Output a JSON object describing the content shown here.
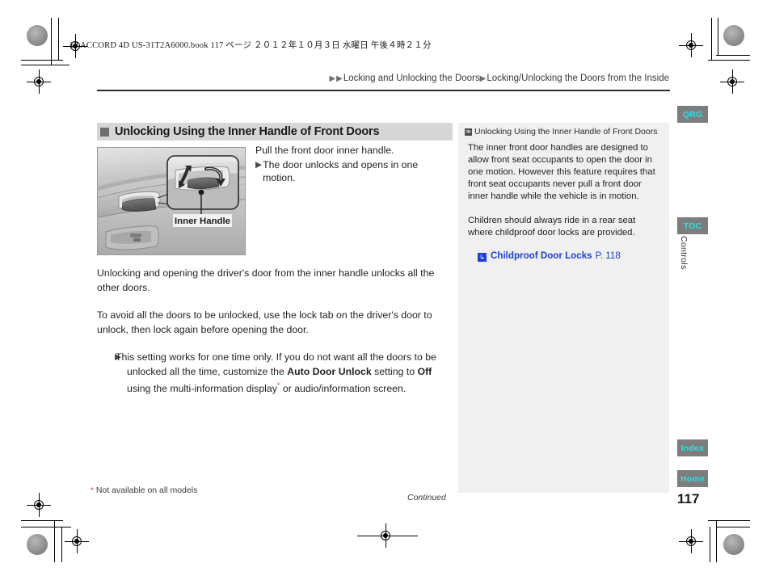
{
  "document": {
    "book_slug": "13 ACCORD 4D US-31T2A6000.book   117 ページ   ２０１２年１０月３日   水曜日   午後４時２１分",
    "page_number": "117",
    "continued_label": "Continued",
    "footnote": "Not available on all models",
    "footnote_marker": "*"
  },
  "breadcrumb": {
    "arrow": "▶",
    "level1": "Locking and Unlocking the Doors",
    "level2": "Locking/Unlocking the Doors from the Inside"
  },
  "section": {
    "heading": "Unlocking Using the Inner Handle of Front Doors",
    "instruction": "Pull the front door inner handle.",
    "instruction_sub": "The door unlocks and opens in one motion.",
    "bullet_arrow": "▶"
  },
  "illustration": {
    "caption": "Inner Handle",
    "alt": "Interior of front door showing the inner door handle with a magnified callout"
  },
  "body": {
    "para1": "Unlocking and opening the driver's door from the inner handle unlocks all the other doors.",
    "para2": "To avoid all the doors to be unlocked, use the lock tab on the driver's door to unlock, then lock again before opening the door.",
    "bullet1_a": "This setting works for one time only. If you do not want all the doors to be unlocked all the time, customize the ",
    "bullet1_bold1": "Auto Door Unlock",
    "bullet1_b": " setting to ",
    "bullet1_bold2": "Off",
    "bullet1_c": " using the multi-information display",
    "bullet1_d": " or audio/information screen."
  },
  "info_panel": {
    "title": "Unlocking Using the Inner Handle of Front Doors",
    "title_icon": "≫",
    "para1": "The inner front door handles are designed to allow front seat occupants to open the door in one motion. However this feature requires that front seat occupants never pull a front door inner handle while the vehicle is in motion.",
    "para2": "Children should always ride in a rear seat where childproof door locks are provided.",
    "link_icon": "↳",
    "link_title": "Childproof Door Locks",
    "link_page": "P. 118"
  },
  "nav_tabs": [
    {
      "id": "qrg",
      "label": "QRG"
    },
    {
      "id": "toc",
      "label": "TOC"
    },
    {
      "id": "index",
      "label": "Index"
    },
    {
      "id": "home",
      "label": "Home"
    }
  ],
  "chapter_tab": "Controls",
  "colors": {
    "heading_bar": "#d6d6d6",
    "info_panel": "#f0f0f0",
    "nav_tab_bg": "#7d7d7d",
    "nav_tab_text": "#2ae0e8",
    "link_blue": "#1c3fd6",
    "asterisk_red": "#e8404a"
  }
}
